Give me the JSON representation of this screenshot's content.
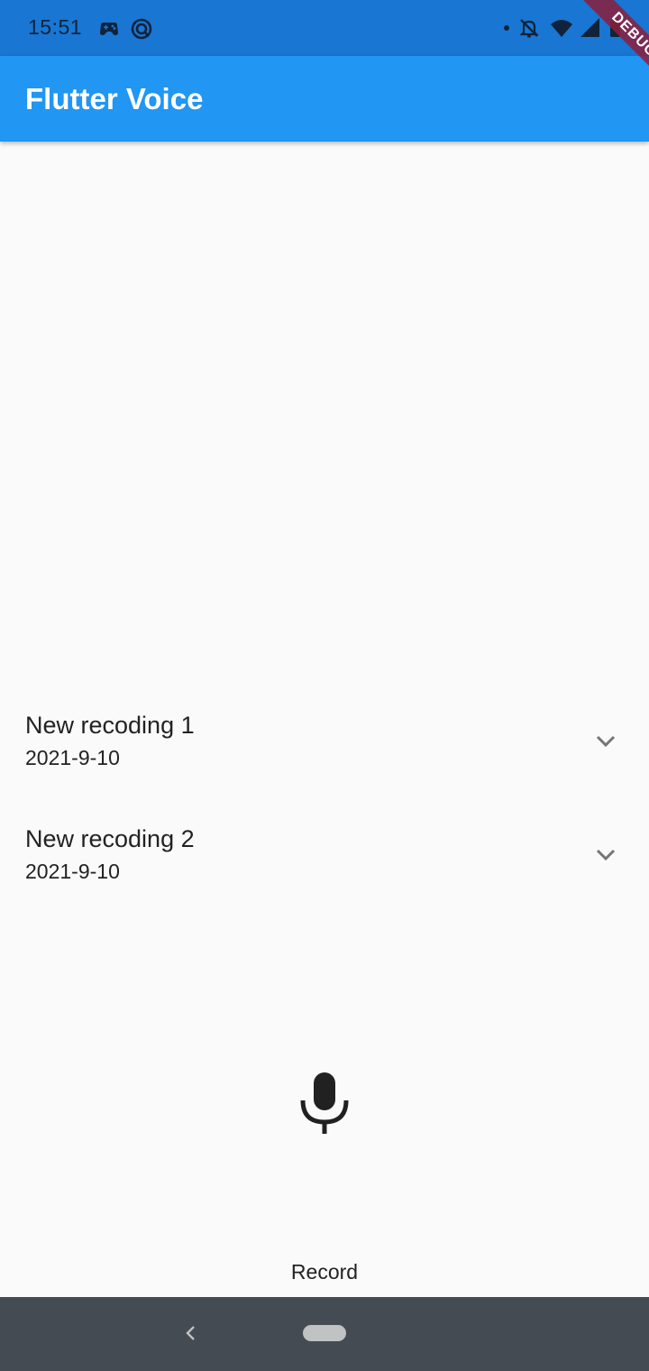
{
  "status_bar": {
    "time": "15:51",
    "left_icons": [
      "gamepad-icon",
      "sync-icon"
    ],
    "right_icons": [
      "notification-dot-icon",
      "bell-off-icon",
      "wifi-icon",
      "signal-icon",
      "battery-icon"
    ]
  },
  "debug_banner": {
    "label": "DEBUG"
  },
  "app_bar": {
    "title": "Flutter Voice"
  },
  "recordings": [
    {
      "title": "New recoding 1",
      "date": "2021-9-10"
    },
    {
      "title": "New recoding 2",
      "date": "2021-9-10"
    }
  ],
  "record": {
    "label": "Record",
    "icon": "mic-icon"
  },
  "nav_bar": {
    "icons": [
      "back-icon",
      "home-pill-icon"
    ]
  },
  "colors": {
    "status_bar": "#1976d2",
    "app_bar": "#2196f3",
    "background": "#fafafa",
    "nav_bar": "#454b53",
    "debug_banner": "#8c1e3c"
  }
}
